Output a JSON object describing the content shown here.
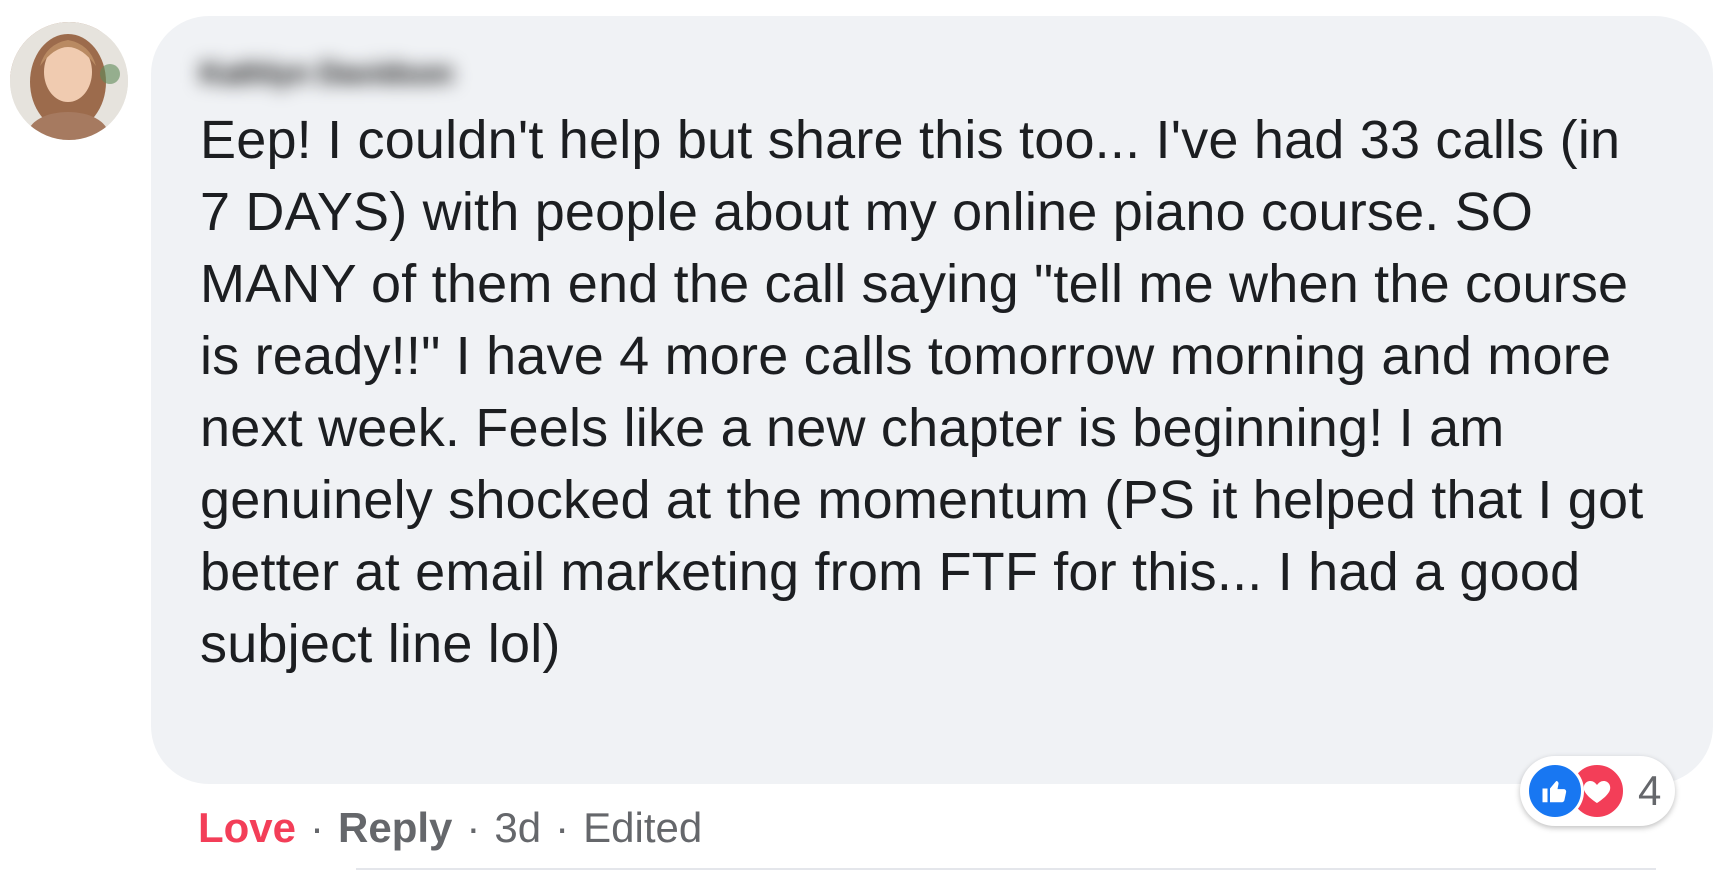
{
  "comment": {
    "author": "Kathlyn Davidson",
    "text": "Eep! I couldn't help but share this too... I've had 33 calls (in 7 DAYS) with people about my online piano course. SO MANY of them end the call saying \"tell me when the course is ready!!\" I have 4 more calls tomorrow morning and more next week. Feels like a new chapter is beginning! I am genuinely shocked at the momentum (PS it helped that I got better at email marketing from FTF for this... I had a good subject line lol)"
  },
  "actions": {
    "love_label": "Love",
    "separator": "·",
    "reply_label": "Reply",
    "time": "3d",
    "edited_label": "Edited"
  },
  "reactions": {
    "icons": [
      "like-icon",
      "heart-icon"
    ],
    "count": "4"
  },
  "colors": {
    "bubble_bg": "#f0f2f5",
    "love_accent": "#f33e58",
    "like_accent": "#1877f2",
    "meta_text": "#65676b"
  }
}
